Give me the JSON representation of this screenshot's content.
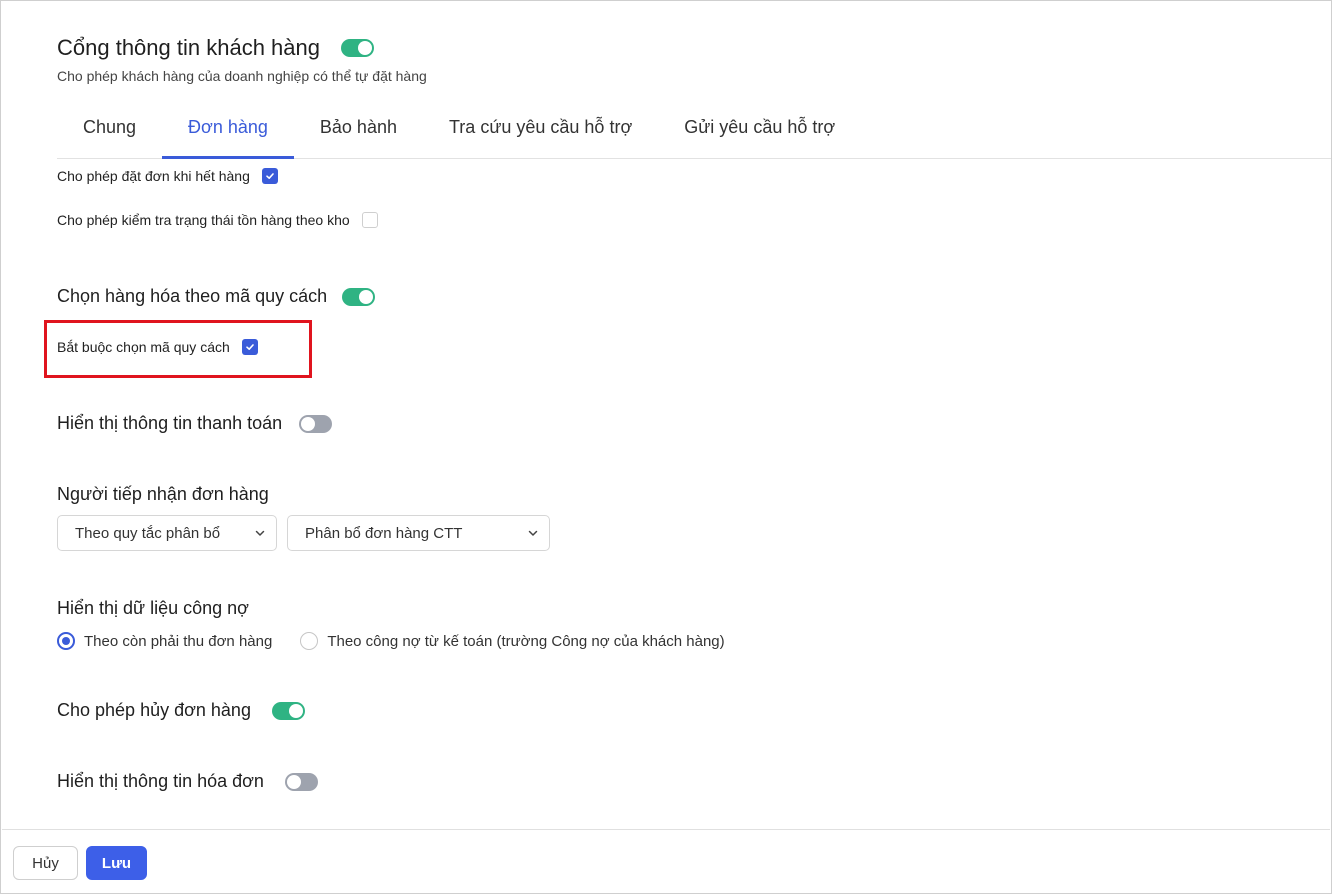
{
  "header": {
    "title": "Cổng thông tin khách hàng",
    "subtitle": "Cho phép khách hàng của doanh nghiệp có thể tự đặt hàng",
    "enabled": true
  },
  "tabs": [
    {
      "label": "Chung",
      "active": false
    },
    {
      "label": "Đơn hàng",
      "active": true
    },
    {
      "label": "Bảo hành",
      "active": false
    },
    {
      "label": "Tra cứu yêu cầu hỗ trợ",
      "active": false
    },
    {
      "label": "Gửi yêu cầu hỗ trợ",
      "active": false
    }
  ],
  "options": {
    "order_out_of_stock": {
      "label": "Cho phép đặt đơn khi hết hàng",
      "checked": true
    },
    "check_stock_by_warehouse": {
      "label": "Cho phép kiểm tra trạng thái tồn hàng theo kho",
      "checked": false
    }
  },
  "spec_code": {
    "label": "Chọn hàng hóa theo mã quy cách",
    "enabled": true,
    "required": {
      "label": "Bắt buộc chọn mã quy cách",
      "checked": true
    }
  },
  "payment_info": {
    "label": "Hiển thị thông tin thanh toán",
    "enabled": false
  },
  "order_receiver": {
    "label": "Người tiếp nhận đơn hàng",
    "rule_select": "Theo quy tắc phân bổ",
    "allocation_select": "Phân bổ đơn hàng CTT"
  },
  "debt_data": {
    "label": "Hiển thị dữ liệu công nợ",
    "options": [
      {
        "label": "Theo còn phải thu đơn hàng",
        "checked": true
      },
      {
        "label": "Theo công nợ từ kế toán (trường Công nợ của khách hàng)",
        "checked": false
      }
    ]
  },
  "cancel_order": {
    "label": "Cho phép hủy đơn hàng",
    "enabled": true
  },
  "invoice_info": {
    "label": "Hiển thị thông tin hóa đơn",
    "enabled": false
  },
  "footer": {
    "cancel_label": "Hủy",
    "save_label": "Lưu"
  },
  "colors": {
    "primary": "#3a5bd9",
    "toggle_on": "#2fb383",
    "toggle_off": "#9ea3ae",
    "highlight": "#e0141e"
  }
}
